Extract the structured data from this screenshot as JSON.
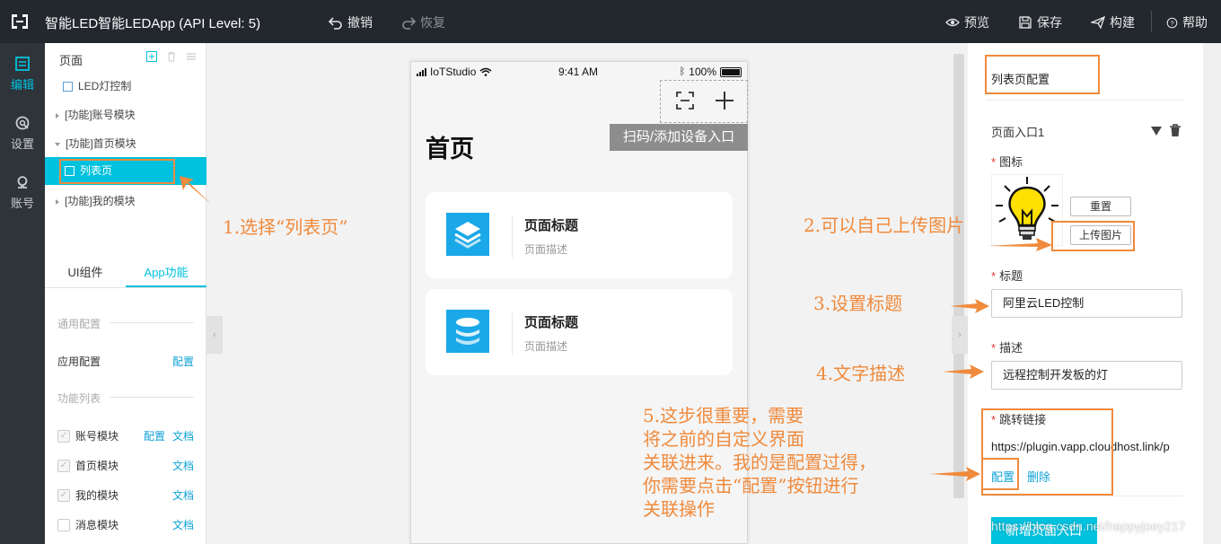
{
  "topbar": {
    "app_title": "智能LED智能LEDApp (API Level: 5)",
    "undo": "撤销",
    "redo": "恢复",
    "preview": "预览",
    "save": "保存",
    "build": "构建",
    "help": "帮助"
  },
  "leftnav": [
    {
      "label": "编辑",
      "icon": "edit-icon",
      "active": true
    },
    {
      "label": "设置",
      "icon": "settings-icon",
      "active": false
    },
    {
      "label": "账号",
      "icon": "account-icon",
      "active": false
    }
  ],
  "pagepanel": {
    "header": "页面",
    "tree": [
      {
        "label": "LED灯控制"
      },
      {
        "label": "[功能]账号模块"
      },
      {
        "label": "[功能]首页模块"
      },
      {
        "label": "列表页"
      },
      {
        "label": "[功能]我的模块"
      }
    ],
    "tabs": [
      "UI组件",
      "App功能"
    ],
    "general_section": "通用配置",
    "app_config": "应用配置",
    "config_link": "配置",
    "function_section": "功能列表",
    "doc_link": "文档",
    "modules": [
      {
        "label": "账号模块"
      },
      {
        "label": "首页模块"
      },
      {
        "label": "我的模块"
      },
      {
        "label": "消息模块"
      }
    ]
  },
  "phone": {
    "carrier": "IoTStudio",
    "time": "9:41 AM",
    "battery": "100%",
    "scan_tip": "扫码/添加设备入口",
    "page_title": "首页",
    "cards": [
      {
        "title": "页面标题",
        "desc": "页面描述"
      },
      {
        "title": "页面标题",
        "desc": "页面描述"
      }
    ]
  },
  "rightpanel": {
    "title": "列表页配置",
    "entry": "页面入口1",
    "icon_label": "图标",
    "reset_btn": "重置",
    "upload_btn": "上传图片",
    "title_label": "标题",
    "title_value": "阿里云LED控制",
    "desc_label": "描述",
    "desc_value": "远程控制开发板的灯",
    "link_label": "跳转链接",
    "link_value": "https://plugin.vapp.cloudhost.link/p",
    "config_link": "配置",
    "delete_link": "删除",
    "add_btn": "新增页面入口"
  },
  "annotations": {
    "a1": "1.选择“列表页”",
    "a2": "2.可以自己上传图片",
    "a3": "3.设置标题",
    "a4": "4.文字描述",
    "a5": [
      "5.这步很重要，需要",
      "将之前的自定义界面",
      "关联进来。我的是配置过得，",
      "你需要点击“配置”按钮进行",
      "关联操作"
    ]
  },
  "watermark": "https://blog.csdn.net/happyjoey217",
  "colors": {
    "accent": "#00c1de",
    "annotation": "#f08a3c",
    "topbar": "#23272e"
  }
}
